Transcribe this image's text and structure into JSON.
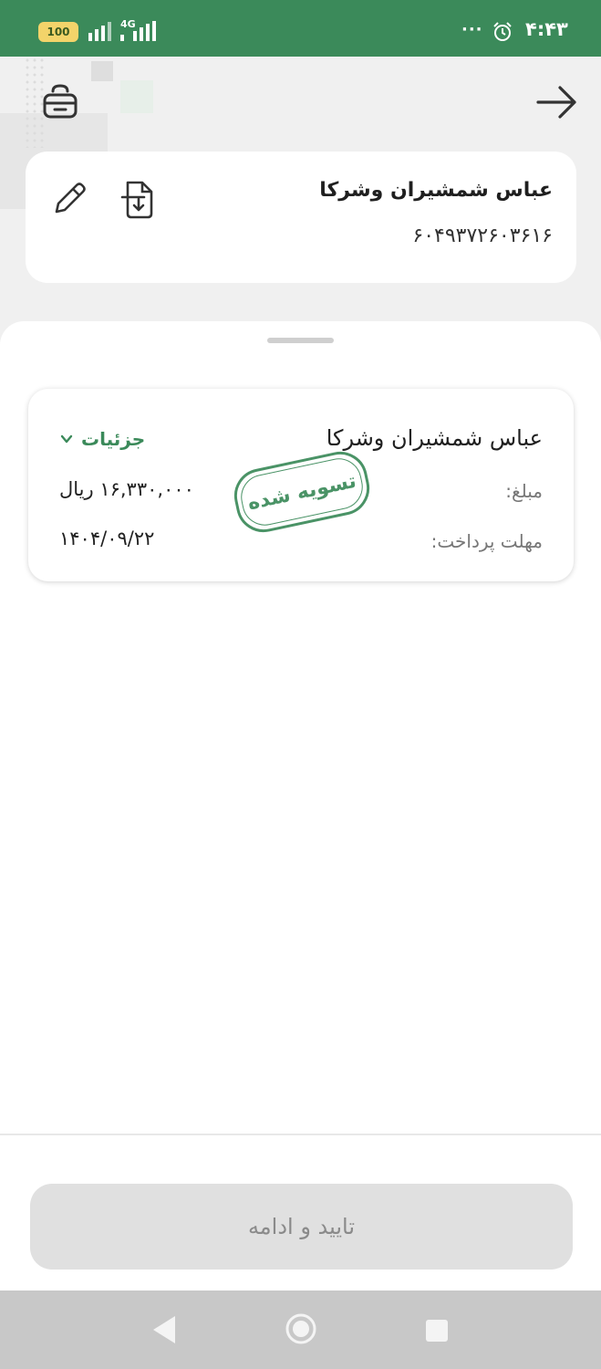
{
  "status_bar": {
    "battery": "100",
    "network": "4G",
    "dots": "···",
    "time": "۴:۴۳",
    "background_color": "#3b8a5a"
  },
  "header": {
    "basket_icon": "basket-icon",
    "back_icon": "arrow-right-icon"
  },
  "payee": {
    "name": "عباس شمشیران وشرکا",
    "id": "۶۰۴۹۳۷۲۶۰۳۶۱۶",
    "download_icon": "document-download-icon",
    "edit_icon": "pencil-icon"
  },
  "bill": {
    "name": "عباس شمشیران وشرکا",
    "details_label": "جزئیات",
    "amount_label": "مبلغ:",
    "amount_value": "۱۶,۳۳۰,۰۰۰ ریال",
    "due_label": "مهلت پرداخت:",
    "due_value": "۱۴۰۴/۰۹/۲۲",
    "stamp_text": "تسویه شده",
    "accent_color": "#3b8a5a"
  },
  "footer": {
    "confirm_label": "تایید و ادامه",
    "confirm_enabled": false
  },
  "nav": {
    "back_icon": "nav-back-icon",
    "home_icon": "nav-home-icon",
    "recent_icon": "nav-recent-icon"
  }
}
